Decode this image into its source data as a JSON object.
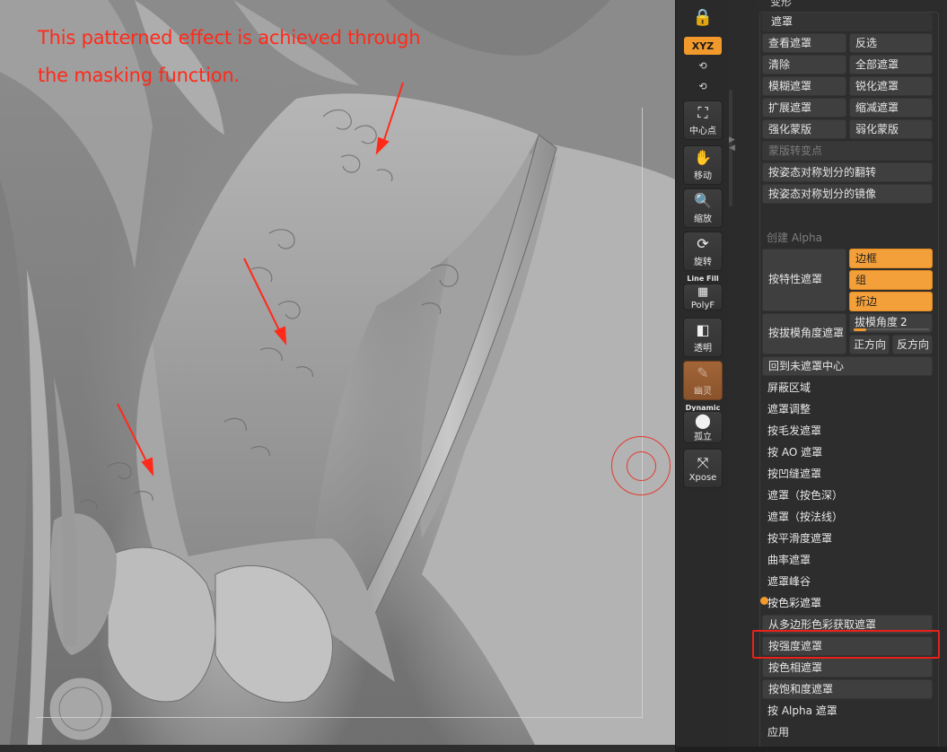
{
  "annotation": {
    "line1": "This patterned effect is achieved through",
    "line2": "the masking function."
  },
  "shelf": {
    "xyz_label": "XYZ",
    "rot1": "⟲",
    "rot2": "⟲",
    "center_label": "中心点",
    "move_label": "移动",
    "scale_label": "缩放",
    "rotate_label": "旋转",
    "linefill_caption": "Line Fill",
    "polyf_label": "PolyF",
    "transp_label": "透明",
    "ghost_label": "幽灵",
    "dynamic_caption": "Dynamic",
    "solo_label": "孤立",
    "xpose_label": "Xpose"
  },
  "panel": {
    "cut_title": "变形",
    "section_title": "遮罩",
    "view_mask": "查看遮罩",
    "invert": "反选",
    "clear": "清除",
    "mask_all": "全部遮罩",
    "blur_mask": "模糊遮罩",
    "sharpen_mask": "锐化遮罩",
    "grow_mask": "扩展遮罩",
    "shrink_mask": "缩减遮罩",
    "enhance_mask": "强化蒙版",
    "weaken_mask": "弱化蒙版",
    "mask_to_points": "蒙版转变点",
    "flip_by_symmetry": "按姿态对称划分的翻转",
    "mirror_by_symmetry": "按姿态对称划分的镜像",
    "create_alpha": "创建 Alpha",
    "mask_by_feature": "按特性遮罩",
    "feature_border": "边框",
    "feature_group": "组",
    "feature_crease": "折边",
    "mask_by_draft": "按拔模角度遮罩",
    "draft_angle_label": "拔模角度",
    "draft_angle_value": "2",
    "positive_dir": "正方向",
    "negative_dir": "反方向",
    "back_to_center": "回到未遮罩中心",
    "mask_area": "屏蔽区域",
    "mask_adjust": "遮罩调整",
    "mask_fibers": "按毛发遮罩",
    "mask_ao": "按 AO 遮罩",
    "mask_cavity": "按凹缝遮罩",
    "mask_by_color_depth": "遮罩（按色深）",
    "mask_by_normal": "遮罩（按法线）",
    "mask_by_smoothness": "按平滑度遮罩",
    "mask_by_curvature": "曲率遮罩",
    "mask_peaks_valleys": "遮罩峰谷",
    "mask_by_color_header": "按色彩遮罩",
    "mask_from_polypaint": "从多边形色彩获取遮罩",
    "mask_by_intensity": "按强度遮罩",
    "mask_by_hue": "按色相遮罩",
    "mask_by_saturation": "按饱和度遮罩",
    "mask_by_alpha": "按 Alpha 遮罩",
    "apply": "应用"
  },
  "colors": {
    "accent": "#f19a2b",
    "highlight": "#e8221a",
    "annotation": "#ff2a1a"
  }
}
